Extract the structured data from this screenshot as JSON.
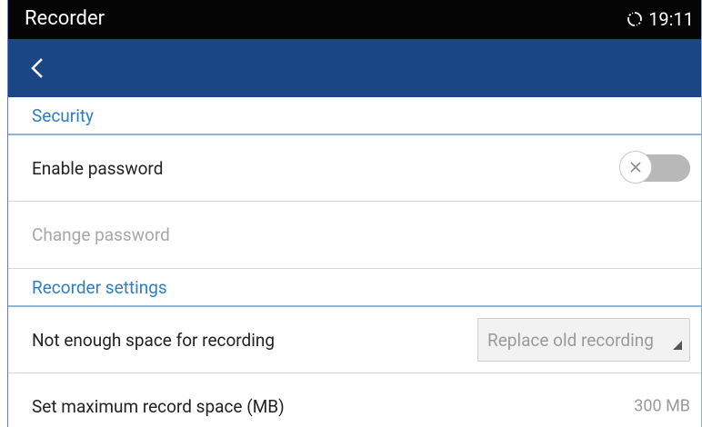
{
  "status_bar": {
    "title": "Recorder",
    "time": "19:11",
    "sync_icon": "sync-icon"
  },
  "app_bar": {
    "back_icon": "chevron-left-icon"
  },
  "sections": [
    {
      "header": "Security",
      "items": [
        {
          "label": "Enable password",
          "control": "toggle",
          "state": "off",
          "enabled": true
        },
        {
          "label": "Change password",
          "control": "none",
          "enabled": false
        }
      ]
    },
    {
      "header": "Recorder settings",
      "items": [
        {
          "label": "Not enough space for recording",
          "control": "dropdown",
          "value": "Replace old recording"
        },
        {
          "label": "Set maximum record space (MB)",
          "control": "value",
          "value": "300 MB"
        }
      ]
    }
  ],
  "colors": {
    "status_bar": "#050505",
    "app_bar": "#1a4685",
    "section_header_text": "#2f7fc1",
    "disabled_text": "#a8a8a8"
  }
}
